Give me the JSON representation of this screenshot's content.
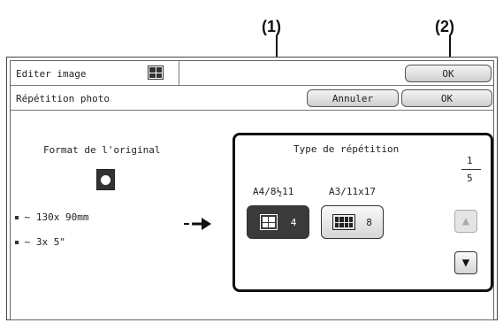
{
  "callouts": {
    "one": "(1)",
    "two": "(2)"
  },
  "header": {
    "title": "Editer image",
    "ok_label": "OK"
  },
  "subheader": {
    "title": "Répétition photo",
    "cancel_label": "Annuler",
    "ok_label": "OK"
  },
  "original": {
    "heading": "Format de l'original",
    "icon": "photo-icon",
    "size_mm": "~ 130x 90mm",
    "size_in": "~ 3x  5\""
  },
  "repetition": {
    "heading": "Type de répétition",
    "page_current": "1",
    "page_total": "5",
    "paper_a4": "A4/8½11",
    "paper_a3": "A3/11x17",
    "option_a4_count": "4",
    "option_a3_count": "8",
    "selected": "4"
  },
  "icons": {
    "up": "up-arrow-icon",
    "down": "down-arrow-icon",
    "arrow": "right-arrow-icon"
  }
}
